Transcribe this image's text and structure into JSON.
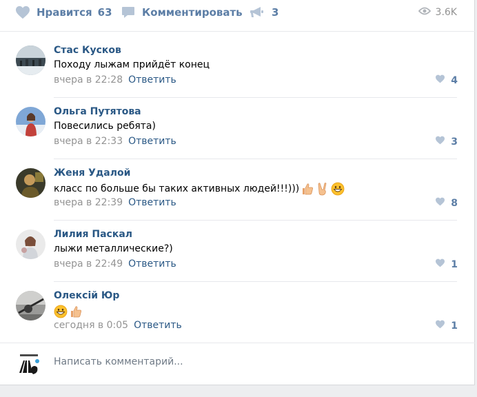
{
  "actions": {
    "like_label": "Нравится",
    "like_count": "63",
    "comment_label": "Комментировать",
    "share_count": "3",
    "views": "3.6K"
  },
  "comments": [
    {
      "author": "Стас Кусков",
      "text": "Походу лыжам прийдёт конец",
      "time": "вчера в 22:28",
      "reply": "Ответить",
      "likes": "4",
      "emoji": []
    },
    {
      "author": "Ольга Путятова",
      "text": "Повесились ребята)",
      "time": "вчера в 22:33",
      "reply": "Ответить",
      "likes": "3",
      "emoji": []
    },
    {
      "author": "Женя Удалой",
      "text": "класс по больше бы таких активных людей!!!)))",
      "time": "вчера в 22:39",
      "reply": "Ответить",
      "likes": "8",
      "emoji": [
        "thumbs-up",
        "victory-hand",
        "grinning-face"
      ]
    },
    {
      "author": "Лилия Паскал",
      "text": "лыжи металлические?)",
      "time": "вчера в 22:49",
      "reply": "Ответить",
      "likes": "1",
      "emoji": []
    },
    {
      "author": "Олексій Юр",
      "text": "",
      "time": "сегодня в 0:05",
      "reply": "Ответить",
      "likes": "1",
      "emoji": [
        "grinning-face",
        "thumbs-up"
      ]
    }
  ],
  "composer": {
    "placeholder": "Написать комментарий..."
  },
  "colors": {
    "link": "#2a5885",
    "action": "#5c7ea6",
    "muted": "#939393",
    "background": "#edeef0"
  }
}
